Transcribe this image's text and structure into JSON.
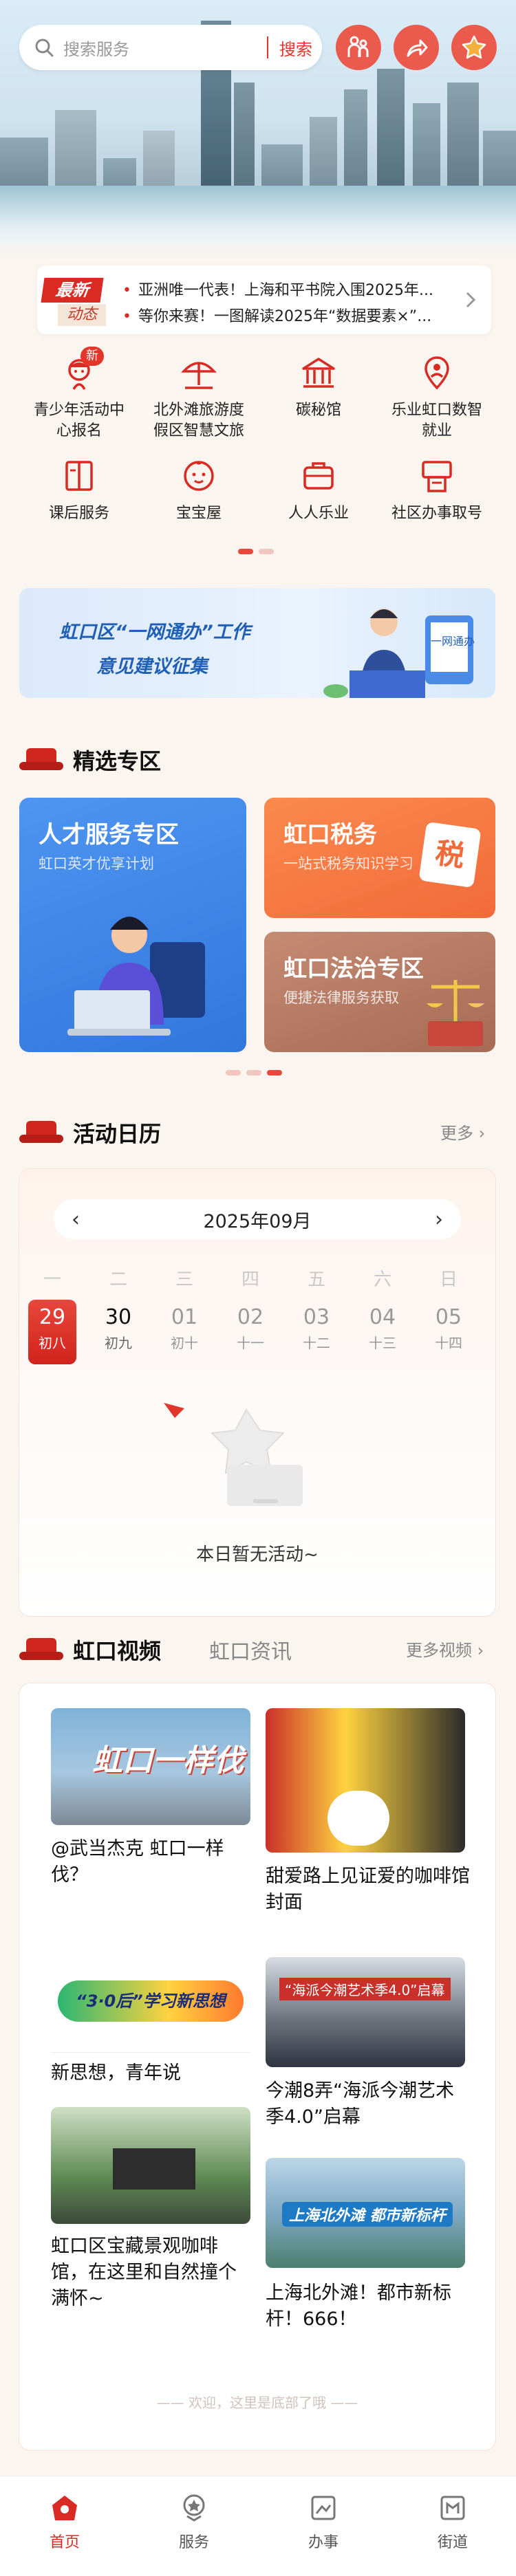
{
  "search": {
    "placeholder": "搜索服务",
    "button": "搜索"
  },
  "header_icons": [
    "family-icon",
    "share-icon",
    "star-icon"
  ],
  "news": {
    "tag_primary": "最新",
    "tag_secondary": "动态",
    "items": [
      "亚洲唯一代表！上海和平书院入围2025年...",
      "等你来赛！一图解读2025年“数据要素×”..."
    ]
  },
  "services": [
    {
      "label": "青少年活动中心报名",
      "icon": "youth-center-icon",
      "badge": "新"
    },
    {
      "label": "北外滩旅游度假区智慧文旅",
      "icon": "umbrella-icon"
    },
    {
      "label": "碳秘馆",
      "icon": "museum-icon"
    },
    {
      "label": "乐业虹口数智就业",
      "icon": "employment-icon"
    },
    {
      "label": "课后服务",
      "icon": "book-icon"
    },
    {
      "label": "宝宝屋",
      "icon": "baby-icon"
    },
    {
      "label": "人人乐业",
      "icon": "briefcase-icon"
    },
    {
      "label": "社区办事取号",
      "icon": "ticket-machine-icon"
    }
  ],
  "banner": {
    "line1": "虹口区“一网通办”工作",
    "line2": "意见建议征集",
    "doc_label": "一网通办"
  },
  "featured": {
    "title": "精选专区",
    "cards": [
      {
        "title": "人才服务专区",
        "subtitle": "虹口英才优享计划"
      },
      {
        "title": "虹口税务",
        "subtitle": "一站式税务知识学习",
        "seal": "税"
      },
      {
        "title": "虹口法治专区",
        "subtitle": "便捷法律服务获取"
      }
    ]
  },
  "calendar": {
    "title": "活动日历",
    "more": "更多",
    "month": "2025年09月",
    "weekdays": [
      "一",
      "二",
      "三",
      "四",
      "五",
      "六",
      "日"
    ],
    "days": [
      {
        "n": "29",
        "l": "初八",
        "selected": true
      },
      {
        "n": "30",
        "l": "初九"
      },
      {
        "n": "01",
        "l": "初十"
      },
      {
        "n": "02",
        "l": "十一"
      },
      {
        "n": "03",
        "l": "十二"
      },
      {
        "n": "04",
        "l": "十三"
      },
      {
        "n": "05",
        "l": "十四"
      }
    ],
    "empty": "本日暂无活动~"
  },
  "videos": {
    "tab_active": "虹口视频",
    "tab_inactive": "虹口资讯",
    "more": "更多视频",
    "items": [
      {
        "title": "@武当杰克  虹口一样伐？",
        "overlay": "虹口一样伐"
      },
      {
        "title": "甜爱路上见证爱的咖啡馆封面"
      },
      {
        "title": "新思想，青年说",
        "overlay": "“3·0后”学习新思想"
      },
      {
        "title": "今潮8弄“海派今潮艺术季4.0”启幕",
        "overlay": "“海派今潮艺术季4.0”启幕"
      },
      {
        "title": "虹口区宝藏景观咖啡馆，在这里和自然撞个满怀~"
      },
      {
        "title": "上海北外滩！都市新标杆！666！",
        "overlay": "上海北外滩  都市新标杆"
      }
    ],
    "footer": "欢迎，这里是底部了哦"
  },
  "tabbar": [
    {
      "label": "首页",
      "icon": "home-icon",
      "active": true
    },
    {
      "label": "服务",
      "icon": "service-icon"
    },
    {
      "label": "办事",
      "icon": "handle-affairs-icon"
    },
    {
      "label": "街道",
      "icon": "street-icon"
    }
  ],
  "colors": {
    "accent": "#e2362b",
    "bg": "#fbf5ef",
    "blue": "#3277dc",
    "orange": "#f26a3a"
  }
}
